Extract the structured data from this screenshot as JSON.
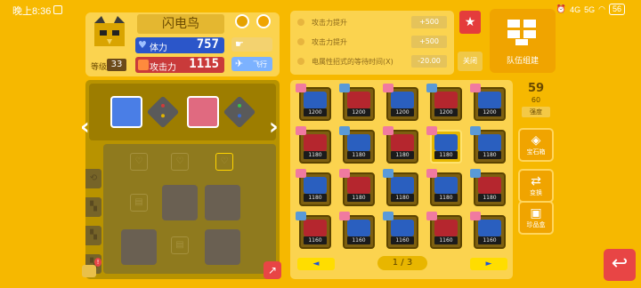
{
  "status_bar": {
    "time": "晚上8:36",
    "signal1": "4G",
    "signal2": "5G",
    "battery": "56"
  },
  "profile": {
    "name": "闪电鸟",
    "level_label": "等级",
    "level": "33",
    "hp_label": "体力",
    "hp_value": "757",
    "atk_label": "攻击力",
    "atk_value": "1115",
    "type_label": "飞行"
  },
  "bonuses": [
    {
      "label": "攻击力提升",
      "value": "+500"
    },
    {
      "label": "攻击力提升",
      "value": "+500"
    },
    {
      "label": "电属性招式的等待时间(X)",
      "value": "-20.00"
    }
  ],
  "close_label": "关闭",
  "team_button_label": "队伍组建",
  "strength": {
    "current": "59",
    "max": "60",
    "label": "强度"
  },
  "side_buttons": [
    {
      "label": "宝石箱",
      "glyph": "◈"
    },
    {
      "label": "变换",
      "glyph": "⇄"
    },
    {
      "label": "珍品盒",
      "glyph": "▣"
    }
  ],
  "pokemon_rows": [
    [
      "1200",
      "1200",
      "1200",
      "1200",
      "1200"
    ],
    [
      "1180",
      "1180",
      "1180",
      "1180",
      "1180"
    ],
    [
      "1180",
      "1180",
      "1180",
      "1180",
      "1180"
    ],
    [
      "1160",
      "1160",
      "1160",
      "1160",
      "1160"
    ]
  ],
  "pager": {
    "label": "1 / 3",
    "prev": "◄",
    "next": "►"
  },
  "colors": {
    "background": "#f6b800",
    "panel": "#fbd34f",
    "hp": "#2b56c9",
    "atk": "#c93a3a",
    "accent_red": "#e84545"
  }
}
